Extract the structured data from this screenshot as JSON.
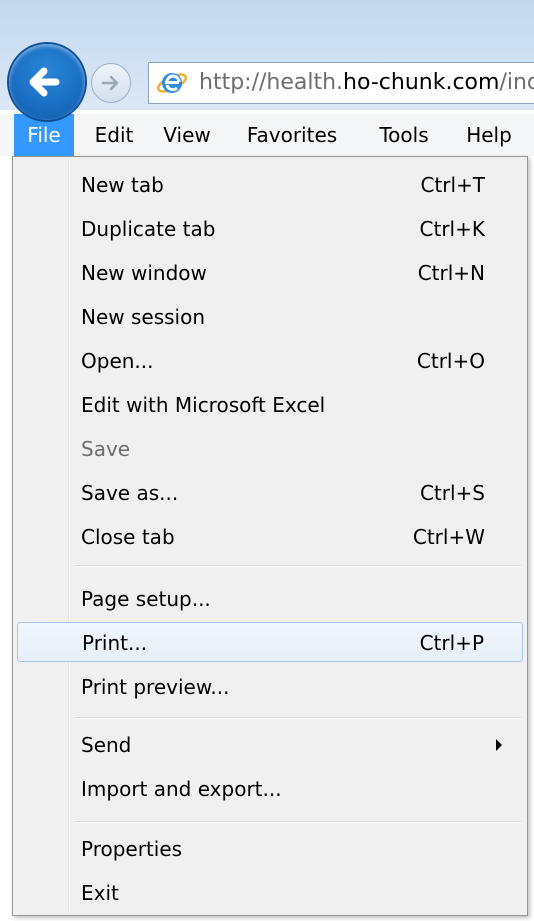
{
  "browser": {
    "url_scheme": "http://health.",
    "url_host": "ho-chunk.com",
    "url_path": "/index",
    "accent_color": "#1a6fc4"
  },
  "menubar": {
    "items": [
      {
        "label": "File"
      },
      {
        "label": "Edit"
      },
      {
        "label": "View"
      },
      {
        "label": "Favorites"
      },
      {
        "label": "Tools"
      },
      {
        "label": "Help"
      }
    ],
    "active": "File",
    "active_color": "#3399ff"
  },
  "file_menu": {
    "items": [
      {
        "label": "New tab",
        "shortcut": "Ctrl+T"
      },
      {
        "label": "Duplicate tab",
        "shortcut": "Ctrl+K"
      },
      {
        "label": "New window",
        "shortcut": "Ctrl+N"
      },
      {
        "label": "New session",
        "shortcut": ""
      },
      {
        "label": "Open...",
        "shortcut": "Ctrl+O"
      },
      {
        "label": "Edit with Microsoft Excel",
        "shortcut": ""
      },
      {
        "label": "Save",
        "shortcut": "",
        "disabled": true
      },
      {
        "label": "Save as...",
        "shortcut": "Ctrl+S"
      },
      {
        "label": "Close tab",
        "shortcut": "Ctrl+W"
      },
      {
        "label": "Page setup...",
        "shortcut": ""
      },
      {
        "label": "Print...",
        "shortcut": "Ctrl+P",
        "highlighted": true
      },
      {
        "label": "Print preview...",
        "shortcut": ""
      },
      {
        "label": "Send",
        "shortcut": "",
        "has_submenu": true
      },
      {
        "label": "Import and export...",
        "shortcut": ""
      },
      {
        "label": "Properties",
        "shortcut": ""
      },
      {
        "label": "Exit",
        "shortcut": ""
      }
    ]
  }
}
